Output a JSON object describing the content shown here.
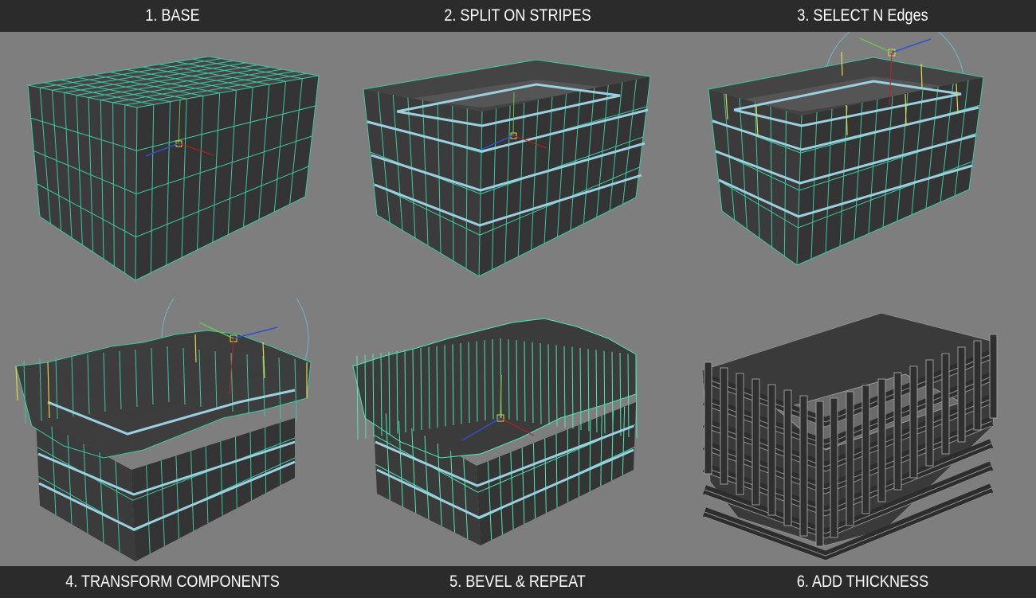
{
  "steps": {
    "s1": "1. BASE",
    "s2": "2. SPLIT ON STRIPES",
    "s3": "3. SELECT N Edges",
    "s4": "4. TRANSFORM COMPONENTS",
    "s5": "5. BEVEL & REPEAT",
    "s6": "6. ADD THICKNESS"
  },
  "colors": {
    "background": "#7e7e7e",
    "bar": "#2b2b2b",
    "wireframe": "#3ec7a3",
    "stripe": "#9ccfe0",
    "selected_edge": "#e6d84a"
  }
}
